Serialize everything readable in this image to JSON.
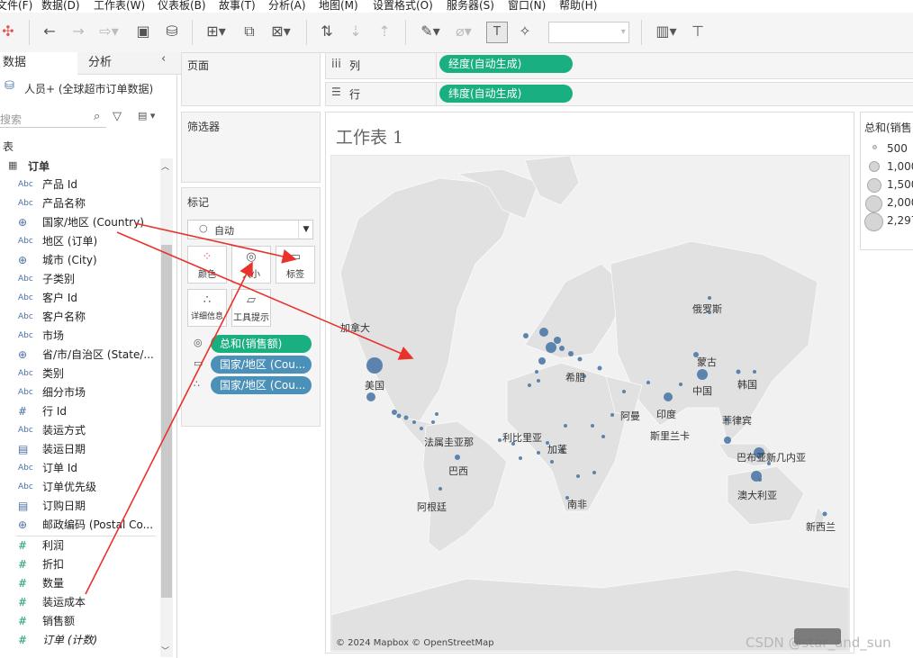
{
  "menu": [
    "文件(F)",
    "数据(D)",
    "工作表(W)",
    "仪表板(B)",
    "故事(T)",
    "分析(A)",
    "地图(M)",
    "设置格式(O)",
    "服务器(S)",
    "窗口(N)",
    "帮助(H)"
  ],
  "datapane": {
    "tab_data": "数据",
    "tab_analysis": "分析",
    "datasource": "人员+ (全球超市订单数据)",
    "search_placeholder": "搜索",
    "tables_label": "表",
    "table_name": "订单",
    "fields": [
      {
        "icon": "Abc",
        "label": "产品 Id"
      },
      {
        "icon": "Abc",
        "label": "产品名称"
      },
      {
        "icon": "globe",
        "label": "国家/地区 (Country)"
      },
      {
        "icon": "Abc",
        "label": "地区 (订单)"
      },
      {
        "icon": "globe",
        "label": "城市 (City)"
      },
      {
        "icon": "Abc",
        "label": "子类别"
      },
      {
        "icon": "Abc",
        "label": "客户 Id"
      },
      {
        "icon": "Abc",
        "label": "客户名称"
      },
      {
        "icon": "Abc",
        "label": "市场"
      },
      {
        "icon": "globe",
        "label": "省/市/自治区 (State/..."
      },
      {
        "icon": "Abc",
        "label": "类别"
      },
      {
        "icon": "Abc",
        "label": "细分市场"
      },
      {
        "icon": "#",
        "label": "行 Id"
      },
      {
        "icon": "Abc",
        "label": "装运方式"
      },
      {
        "icon": "calendar",
        "label": "装运日期"
      },
      {
        "icon": "Abc",
        "label": "订单 Id"
      },
      {
        "icon": "Abc",
        "label": "订单优先级"
      },
      {
        "icon": "calendar",
        "label": "订购日期"
      },
      {
        "icon": "globe",
        "label": "邮政编码 (Postal Co..."
      }
    ],
    "measures": [
      "利润",
      "折扣",
      "数量",
      "装运成本",
      "销售额",
      "订单 (计数)"
    ]
  },
  "shelves": {
    "pages_label": "页面",
    "filters_label": "筛选器",
    "marks_label": "标记",
    "mark_type": "自动",
    "mark_buttons": [
      "颜色",
      "大小",
      "标签",
      "详细信息",
      "工具提示"
    ],
    "mark_pills": [
      "总和(销售额)",
      "国家/地区 (Cou...",
      "国家/地区 (Cou..."
    ],
    "columns_label": "列",
    "columns_pill": "经度(自动生成)",
    "rows_label": "行",
    "rows_pill": "纬度(自动生成)"
  },
  "sheet": {
    "title": "工作表 1",
    "attribution": "© 2024 Mapbox © OpenStreetMap",
    "map_labels": [
      "加拿大",
      "俄罗斯",
      "美国",
      "希腊",
      "蒙古",
      "中国",
      "韩国",
      "阿曼",
      "印度",
      "菲律宾",
      "斯里兰卡",
      "利比里亚",
      "法属圭亚那",
      "加蓬",
      "巴西",
      "巴布亚新几内亚",
      "澳大利亚",
      "南非",
      "阿根廷",
      "新西兰"
    ]
  },
  "legend": {
    "title": "总和(销售",
    "items": [
      "500",
      "1,000",
      "1,500",
      "2,000",
      "2,297"
    ]
  },
  "watermark": "CSDN @star_and_sun",
  "colors": {
    "green_pill": "#1aaf80",
    "blue_pill": "#4a90b8",
    "mark": "#4e79a7",
    "annotation": "#e8322b"
  }
}
